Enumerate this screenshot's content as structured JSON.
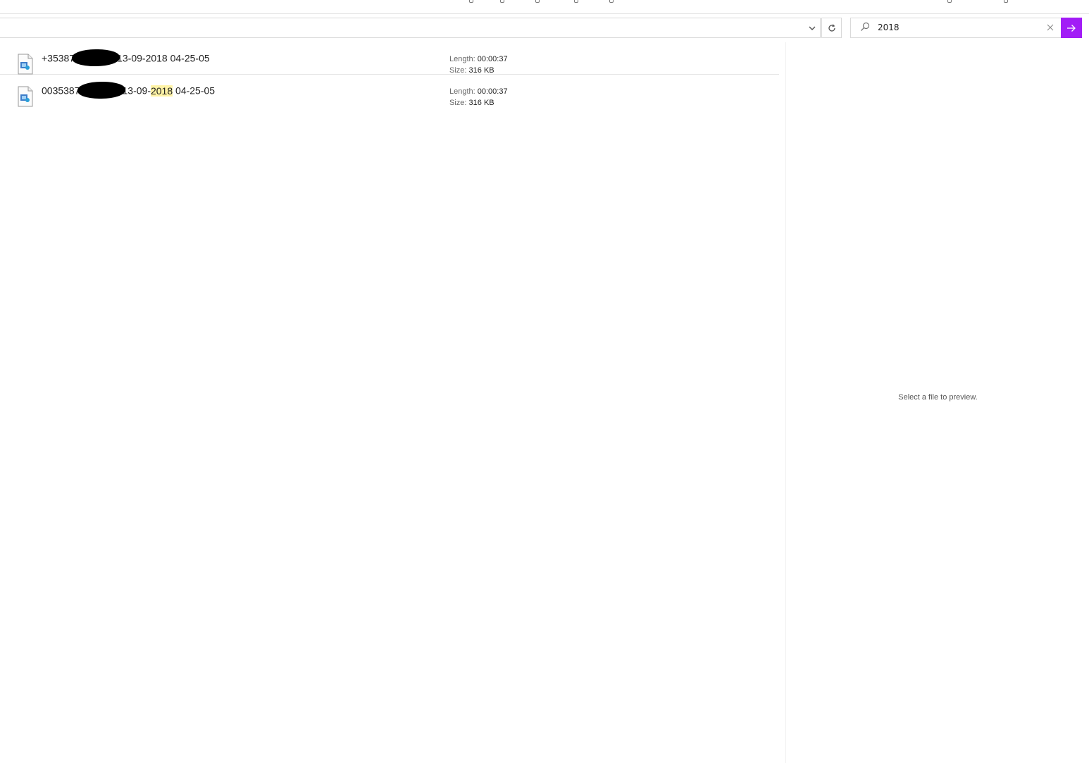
{
  "search": {
    "value": "2018",
    "icon": "search-icon",
    "clear_icon": "close-icon",
    "go_icon": "arrow-right-icon",
    "accent": "#a21cf6"
  },
  "address_bar": {
    "dropdown_icon": "chevron-down-icon",
    "refresh_icon": "refresh-icon"
  },
  "results": [
    {
      "name_prefix": "+35387",
      "name_mid": "13-09-2018 04-25-05",
      "highlight": "",
      "name_suffix": "",
      "length_label": "Length:",
      "length_value": "00:00:37",
      "size_label": "Size:",
      "size_value": "316 KB"
    },
    {
      "name_prefix": "0035387",
      "name_mid": "13-09-",
      "highlight": "2018",
      "name_suffix": " 04-25-05",
      "length_label": "Length:",
      "length_value": "00:00:37",
      "size_label": "Size:",
      "size_value": "316 KB"
    }
  ],
  "preview": {
    "empty_message": "Select a file to preview."
  }
}
